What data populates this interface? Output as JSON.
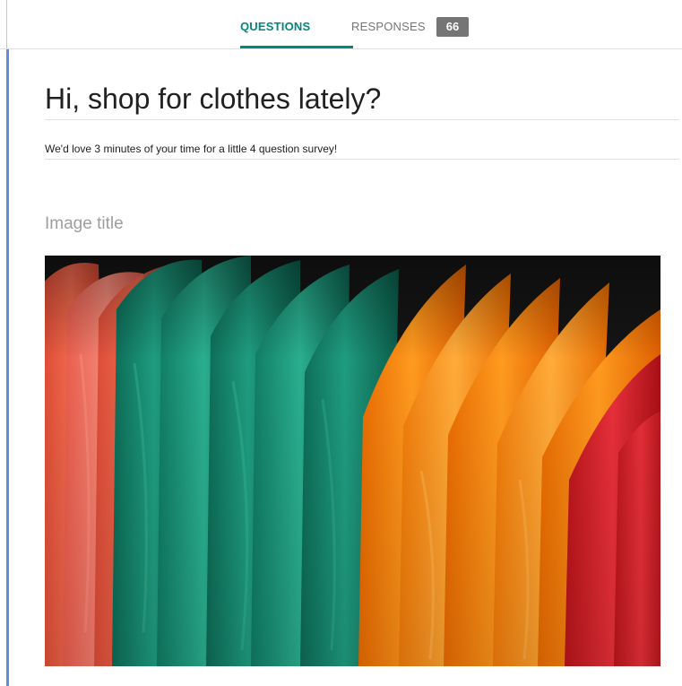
{
  "tabs": {
    "questions_label": "QUESTIONS",
    "responses_label": "RESPONSES",
    "responses_count": "66"
  },
  "form": {
    "title": "Hi, shop for clothes lately?",
    "description": "We'd love 3 minutes of your time for a little 4 question survey!"
  },
  "image_item": {
    "title": "Image title",
    "image_subject": "shirts-on-rack-photo"
  },
  "colors": {
    "accent_teal": "#00897b",
    "card_accent": "#5b8edb",
    "badge_gray": "#757575"
  }
}
